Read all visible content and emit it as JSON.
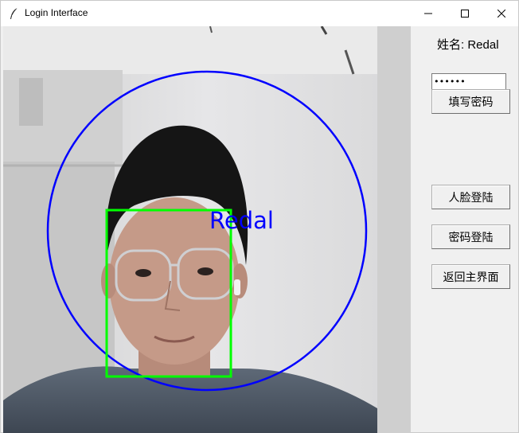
{
  "window": {
    "title": "Login Interface",
    "icon": "feather-icon",
    "controls": [
      "minimize-icon",
      "maximize-icon",
      "close-icon"
    ]
  },
  "camera": {
    "overlay_name": "Redal",
    "detection_circle_color": "#0000ff",
    "face_box_color": "#00ff00",
    "overlay_text_color": "#0000ff"
  },
  "panel": {
    "name_label": "姓名: Redal",
    "password_value": "******",
    "fill_password_button": "填写密码",
    "face_login_button": "人脸登陆",
    "password_login_button": "密码登陆",
    "back_main_button": "返回主界面"
  }
}
